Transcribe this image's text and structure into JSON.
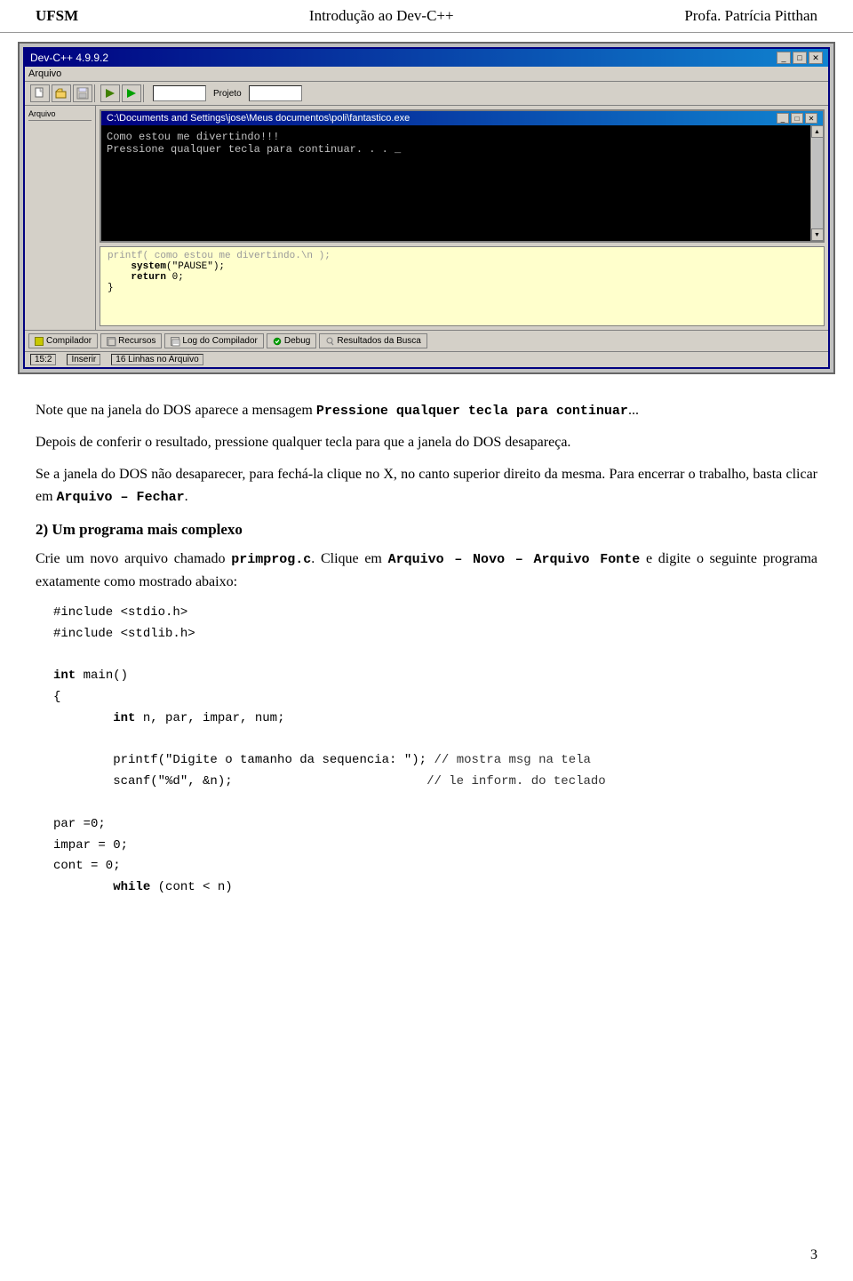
{
  "header": {
    "left": "UFSM",
    "center": "Introdução ao Dev-C++",
    "right": "Profa. Patrícia Pitthan"
  },
  "ide": {
    "title": "Dev-C++ 4.9.9.2",
    "menubar": "Arquivo",
    "console": {
      "title": "C:\\Documents and Settings\\jose\\Meus documentos\\poli\\fantastico.exe",
      "line1": "Como estou me divertindo!!!",
      "line2": "Pressione qualquer tecla para continuar. . . _"
    },
    "code": {
      "line1": "printf( como estou me divertindo.\\n );",
      "line2": "system(\"PAUSE\");",
      "line3": "return 0;",
      "line4": "}"
    },
    "bottom_tabs": [
      "Compilador",
      "Recursos",
      "Log do Compilador",
      "Debug",
      "Resultados da Busca"
    ],
    "statusbar": {
      "position": "15:2",
      "mode": "Inserir",
      "lines": "16 Linhas no Arquivo"
    }
  },
  "paragraphs": {
    "p1": "Note que na janela do DOS aparece a mensagem ",
    "p1_code": "Pressione qualquer tecla para continuar",
    "p1_end": "...",
    "p2": "Depois de conferir o resultado, pressione qualquer tecla para que a janela do DOS desapareça.",
    "p3_start": "Se a janela do DOS não desaparecer, para fechá-la clique no X, no canto superior direito da mesma. Para encerrar o trabalho, basta clicar em ",
    "p3_code": "Arquivo – Fechar",
    "p3_end": "."
  },
  "section2": {
    "title": "2)  Um programa mais complexo",
    "intro": "Crie um novo arquivo chamado ",
    "filename": "primprog.c",
    "intro2": ". Clique em ",
    "menu_cmd": "Arquivo – Novo – Arquivo Fonte",
    "intro3": " e digite o seguinte programa exatamente como mostrado abaixo:"
  },
  "code_program": {
    "include1": "#include <stdio.h>",
    "include2": "#include <stdlib.h>",
    "blank1": "",
    "main_sig": "int main()",
    "open_brace": "{",
    "decl": "        int n, par, impar, num;",
    "blank2": "",
    "printf1": "        printf(\"Digite o tamanho da sequencia: \"); // mostra msg na tela",
    "scanf1": "        scanf(\"%d\", &n);                          // le inform. do teclado",
    "blank3": "",
    "par_init": "        par =0;",
    "impar_init": "        impar = 0;",
    "cont_init": "        cont = 0;",
    "while_line": "        while (cont < n)"
  },
  "page_number": "3"
}
